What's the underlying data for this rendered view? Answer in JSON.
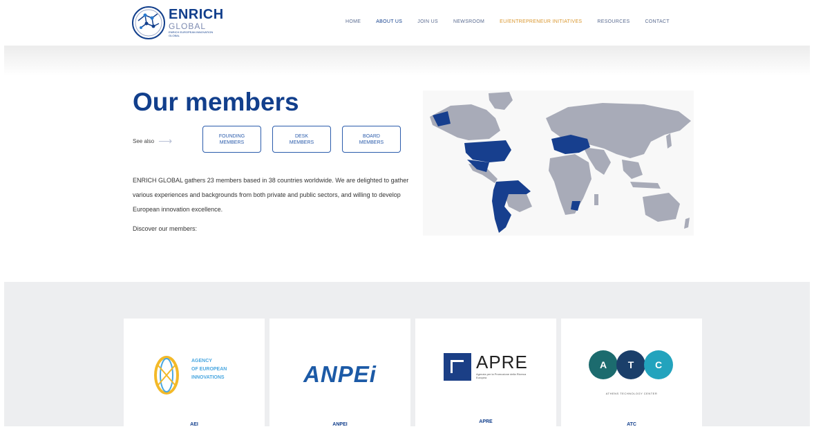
{
  "header": {
    "logo": {
      "brand": "ENRICH",
      "sub": "GLOBAL",
      "tagline": "ENRICH EUROPEAN INNOVATION GLOBAL"
    },
    "nav": [
      "HOME",
      "ABOUT US",
      "JOIN US",
      "NEWSROOM",
      "EU/ENTREPRENEUR INITIATIVES",
      "RESOURCES",
      "CONTACT"
    ]
  },
  "hero": {
    "title": "Our members",
    "see_also": "See also",
    "buttons": [
      {
        "line1": "FOUNDING",
        "line2": "MEMBERS"
      },
      {
        "line1": "DESK",
        "line2": "MEMBERS"
      },
      {
        "line1": "BOARD",
        "line2": "MEMBERS"
      }
    ],
    "intro": "ENRICH GLOBAL gathers 23 members based in 38 countries worldwide. We are delighted to gather various experiences and backgrounds from both private and public sectors, and willing to develop European innovation excellence.",
    "discover": "Discover our members:"
  },
  "members": [
    {
      "name": "AEI",
      "logo_lines": [
        "AGENCY",
        "OF EUROPEAN",
        "INNOVATIONS"
      ]
    },
    {
      "name": "ANPEI",
      "logo_text": "ANPEi"
    },
    {
      "name": "APRE",
      "logo_text": "APRE",
      "logo_sub": "Agenzia per la Promozione della Ricerca Europea"
    },
    {
      "name": "ATC",
      "logo_letters": [
        "A",
        "T",
        "C"
      ],
      "logo_sub": "ATHENS TECHNOLOGY CENTER"
    }
  ],
  "colors": {
    "brand": "#123f8c",
    "accent_orange": "#d9952b",
    "map_land": "#a8abb8",
    "map_highlight": "#173f8e",
    "section_bg": "#edeef0"
  }
}
